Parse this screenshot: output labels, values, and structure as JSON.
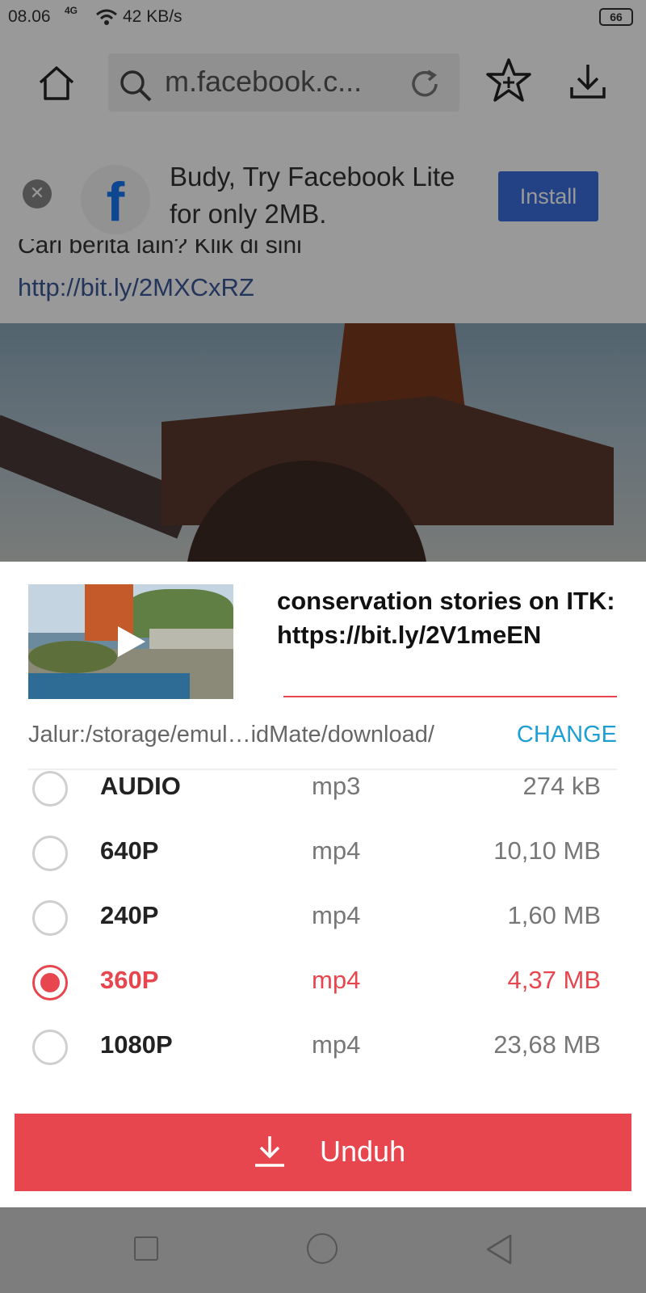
{
  "status_bar": {
    "time": "08.06",
    "network": "4G",
    "speed": "42 KB/s",
    "battery": "66"
  },
  "browser": {
    "url": "m.facebook.c...",
    "icons": [
      "home-icon",
      "search-icon",
      "reload-icon",
      "bookmark-add-icon",
      "download-icon"
    ]
  },
  "ad": {
    "text": "Budy, Try Facebook Lite for only 2MB.",
    "logo": "f",
    "close": "✕",
    "install_label": "Install"
  },
  "post": {
    "partial_text": "Cari berita lain? Klik di sini",
    "link": "http://bit.ly/2MXCxRZ"
  },
  "download_sheet": {
    "title": "conservation stories on ITK: https://bit.ly/2V1meEN",
    "path": "Jalur:/storage/emul…idMate/download/",
    "change_label": "CHANGE",
    "options": [
      {
        "quality": "AUDIO",
        "format": "mp3",
        "size": "274 kB",
        "selected": false
      },
      {
        "quality": "640P",
        "format": "mp4",
        "size": "10,10 MB",
        "selected": false
      },
      {
        "quality": "240P",
        "format": "mp4",
        "size": "1,60 MB",
        "selected": false
      },
      {
        "quality": "360P",
        "format": "mp4",
        "size": "4,37 MB",
        "selected": true
      },
      {
        "quality": "1080P",
        "format": "mp4",
        "size": "23,68 MB",
        "selected": false
      }
    ],
    "download_label": "Unduh",
    "accent_color": "#e8464f",
    "link_color": "#1e9fd4"
  }
}
